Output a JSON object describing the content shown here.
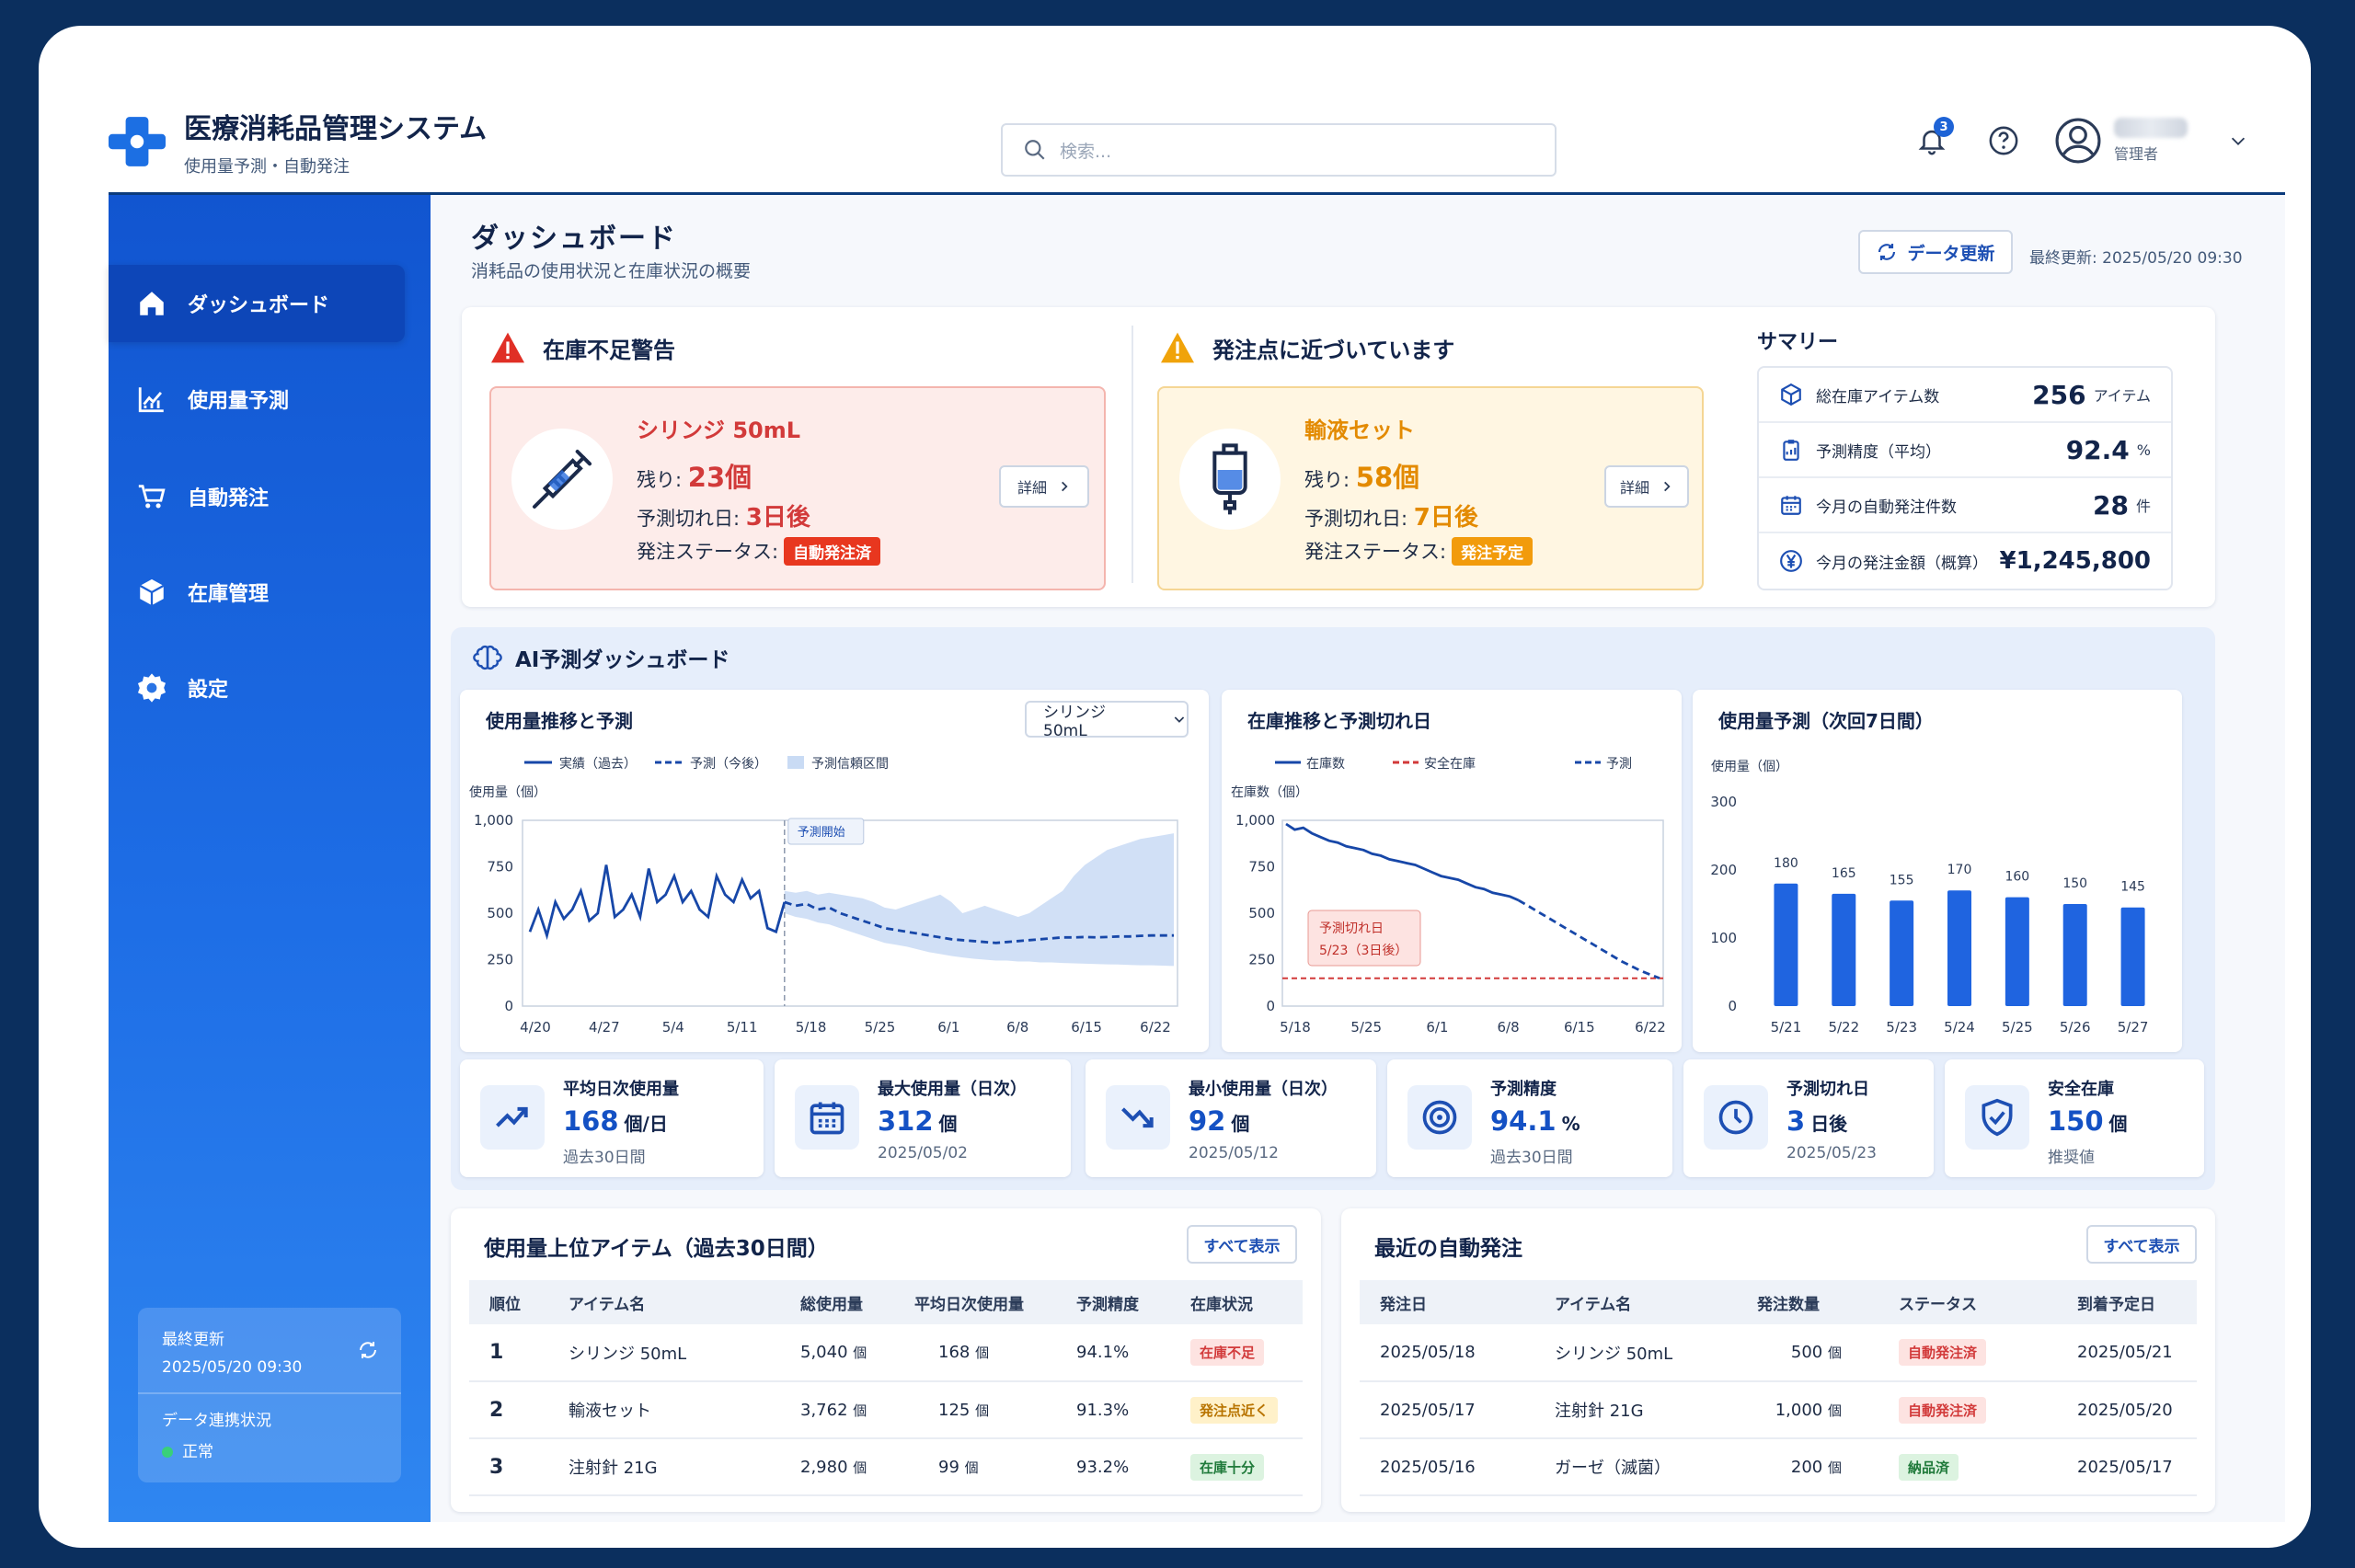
{
  "app": {
    "title": "医療消耗品管理システム",
    "subtitle": "使用量予測・自動発注"
  },
  "search": {
    "placeholder": "検索..."
  },
  "header": {
    "notification_count": "3",
    "user_role": "管理者"
  },
  "sidebar": {
    "items": [
      {
        "label": "ダッシュボード",
        "icon": "home-icon"
      },
      {
        "label": "使用量予測",
        "icon": "chart-icon"
      },
      {
        "label": "自動発注",
        "icon": "cart-icon"
      },
      {
        "label": "在庫管理",
        "icon": "box-icon"
      },
      {
        "label": "設定",
        "icon": "gear-icon"
      }
    ],
    "status": {
      "last_update_label": "最終更新",
      "last_update_value": "2025/05/20 09:30",
      "link_label": "データ連携状況",
      "link_value": "正常"
    }
  },
  "page": {
    "title": "ダッシュボード",
    "subtitle": "消耗品の使用状況と在庫状況の概要",
    "refresh_label": "データ更新",
    "last_updated": "最終更新: 2025/05/20 09:30"
  },
  "alerts": {
    "shortage": {
      "title": "在庫不足警告",
      "item": "シリンジ 50mL",
      "remain_label": "残り:",
      "remain_value": "23個",
      "runout_label": "予測切れ日:",
      "runout_value": "3日後",
      "status_label": "発注ステータス:",
      "status_value": "自動発注済",
      "detail_label": "詳細"
    },
    "near": {
      "title": "発注点に近づいています",
      "item": "輸液セット",
      "remain_label": "残り:",
      "remain_value": "58個",
      "runout_label": "予測切れ日:",
      "runout_value": "7日後",
      "status_label": "発注ステータス:",
      "status_value": "発注予定",
      "detail_label": "詳細"
    }
  },
  "summary": {
    "title": "サマリー",
    "rows": [
      {
        "label": "総在庫アイテム数",
        "value": "256",
        "unit": "アイテム",
        "icon": "cube-icon"
      },
      {
        "label": "予測精度（平均）",
        "value": "92.4",
        "unit": "%",
        "icon": "clipboard-icon"
      },
      {
        "label": "今月の自動発注件数",
        "value": "28",
        "unit": "件",
        "icon": "calendar-icon"
      },
      {
        "label": "今月の発注金額（概算）",
        "value": "¥1,245,800",
        "unit": "",
        "icon": "yen-icon"
      }
    ]
  },
  "ai": {
    "title": "AI予測ダッシュボード"
  },
  "chart_data": [
    {
      "type": "line",
      "title": "使用量推移と予測",
      "select_value": "シリンジ 50mL",
      "ylabel": "使用量（個）",
      "ylim": [
        0,
        1000
      ],
      "yticks": [
        "1,000",
        "750",
        "500",
        "250",
        "0"
      ],
      "x_tick_labels": [
        "4/20",
        "4/27",
        "5/4",
        "5/11",
        "5/18",
        "5/25",
        "6/1",
        "6/8",
        "6/15",
        "6/22"
      ],
      "annotation": "予測開始",
      "legend": [
        "実績（過去）",
        "予測（今後）",
        "予測信頼区間"
      ],
      "colors": {
        "actual": "#1747a8",
        "forecast": "#1747a8",
        "band": "#c9dbf4"
      },
      "series": [
        {
          "name": "実績（過去）",
          "values": [
            400,
            520,
            380,
            560,
            470,
            520,
            620,
            460,
            500,
            760,
            480,
            520,
            600,
            480,
            740,
            560,
            600,
            700,
            560,
            620,
            520,
            480,
            700,
            600,
            560,
            680,
            580,
            620,
            420,
            400,
            560
          ]
        },
        {
          "name": "予測（今後）",
          "values": [
            560,
            540,
            550,
            520,
            530,
            500,
            480,
            460,
            440,
            420,
            410,
            400,
            390,
            380,
            370,
            360,
            355,
            350,
            345,
            340,
            345,
            350,
            355,
            360,
            365,
            370,
            370,
            372,
            370,
            372,
            375,
            375,
            378,
            380,
            380,
            380
          ]
        },
        {
          "name": "予測信頼区間",
          "lower": [
            500,
            480,
            470,
            450,
            440,
            420,
            400,
            380,
            360,
            340,
            330,
            320,
            305,
            290,
            280,
            270,
            262,
            255,
            250,
            245,
            245,
            240,
            240,
            235,
            235,
            232,
            230,
            228,
            226,
            225,
            224,
            222,
            220,
            220,
            218,
            216
          ],
          "upper": [
            620,
            610,
            620,
            600,
            610,
            600,
            590,
            580,
            560,
            530,
            520,
            540,
            560,
            580,
            600,
            560,
            500,
            520,
            540,
            520,
            500,
            480,
            500,
            540,
            580,
            620,
            700,
            760,
            800,
            840,
            860,
            880,
            900,
            910,
            920,
            930
          ]
        }
      ]
    },
    {
      "type": "line",
      "title": "在庫推移と予測切れ日",
      "ylabel": "在庫数（個）",
      "ylim": [
        0,
        1000
      ],
      "yticks": [
        "1,000",
        "750",
        "500",
        "250",
        "0"
      ],
      "x_tick_labels": [
        "5/18",
        "5/25",
        "6/1",
        "6/8",
        "6/15",
        "6/22"
      ],
      "legend": [
        "在庫数",
        "安全在庫",
        "予測"
      ],
      "annotation": "予測切れ日\n5/23（3日後）",
      "safety_stock": 150,
      "colors": {
        "stock": "#1747a8",
        "safety": "#d23a3a"
      },
      "series": [
        {
          "name": "在庫数",
          "values": [
            980,
            950,
            960,
            930,
            910,
            890,
            880,
            860,
            850,
            840,
            820,
            810,
            790,
            780,
            770,
            760,
            740,
            720,
            700,
            690,
            680,
            660,
            640,
            630,
            610,
            600,
            590,
            570
          ]
        },
        {
          "name": "予測",
          "values": [
            570,
            540,
            510,
            480,
            450,
            420,
            390,
            360,
            330,
            300,
            270,
            240,
            215,
            190,
            170,
            150
          ]
        }
      ]
    },
    {
      "type": "bar",
      "title": "使用量予測（次回7日間）",
      "ylabel": "使用量（個）",
      "ylim": [
        0,
        300
      ],
      "yticks": [
        "300",
        "200",
        "100",
        "0"
      ],
      "categories": [
        "5/21",
        "5/22",
        "5/23",
        "5/24",
        "5/25",
        "5/26",
        "5/27"
      ],
      "values": [
        180,
        165,
        155,
        170,
        160,
        150,
        145
      ],
      "colors": {
        "bar": "#1f64e0"
      }
    }
  ],
  "stats": [
    {
      "label": "平均日次使用量",
      "value": "168",
      "unit": "個/日",
      "desc": "過去30日間",
      "icon": "trend-up-icon"
    },
    {
      "label": "最大使用量（日次）",
      "value": "312",
      "unit": "個",
      "desc": "2025/05/02",
      "icon": "calendar-icon"
    },
    {
      "label": "最小使用量（日次）",
      "value": "92",
      "unit": "個",
      "desc": "2025/05/12",
      "icon": "trend-down-icon"
    },
    {
      "label": "予測精度",
      "value": "94.1",
      "unit": "%",
      "desc": "過去30日間",
      "icon": "target-icon"
    },
    {
      "label": "予測切れ日",
      "value": "3",
      "unit": "日後",
      "desc": "2025/05/23",
      "icon": "clock-icon"
    },
    {
      "label": "安全在庫",
      "value": "150",
      "unit": "個",
      "desc": "推奨値",
      "icon": "shield-icon"
    }
  ],
  "top_items": {
    "title": "使用量上位アイテム（過去30日間）",
    "all_label": "すべて表示",
    "headers": [
      "順位",
      "アイテム名",
      "総使用量",
      "平均日次使用量",
      "予測精度",
      "在庫状況"
    ],
    "rows": [
      {
        "rank": "1",
        "name": "シリンジ 50mL",
        "total": "5,040",
        "total_unit": "個",
        "avg": "168",
        "avg_unit": "個",
        "acc": "94.1%",
        "status": "在庫不足",
        "status_color": "#d23a3a",
        "status_bg": "#fde3e1"
      },
      {
        "rank": "2",
        "name": "輸液セット",
        "total": "3,762",
        "total_unit": "個",
        "avg": "125",
        "avg_unit": "個",
        "acc": "91.3%",
        "status": "発注点近く",
        "status_color": "#b87400",
        "status_bg": "#fff1c9"
      },
      {
        "rank": "3",
        "name": "注射針 21G",
        "total": "2,980",
        "total_unit": "個",
        "avg": "99",
        "avg_unit": "個",
        "acc": "93.2%",
        "status": "在庫十分",
        "status_color": "#1f7a3a",
        "status_bg": "#dcf3e0"
      }
    ]
  },
  "recent_orders": {
    "title": "最近の自動発注",
    "all_label": "すべて表示",
    "headers": [
      "発注日",
      "アイテム名",
      "発注数量",
      "ステータス",
      "到着予定日"
    ],
    "rows": [
      {
        "date": "2025/05/18",
        "name": "シリンジ 50mL",
        "qty": "500",
        "qty_unit": "個",
        "status": "自動発注済",
        "status_color": "#d23a3a",
        "status_bg": "#fde3e1",
        "eta": "2025/05/21"
      },
      {
        "date": "2025/05/17",
        "name": "注射針 21G",
        "qty": "1,000",
        "qty_unit": "個",
        "status": "自動発注済",
        "status_color": "#d23a3a",
        "status_bg": "#fde3e1",
        "eta": "2025/05/20"
      },
      {
        "date": "2025/05/16",
        "name": "ガーゼ（滅菌）",
        "qty": "200",
        "qty_unit": "個",
        "status": "納品済",
        "status_color": "#1f7a3a",
        "status_bg": "#dcf3e0",
        "eta": "2025/05/17"
      }
    ]
  }
}
